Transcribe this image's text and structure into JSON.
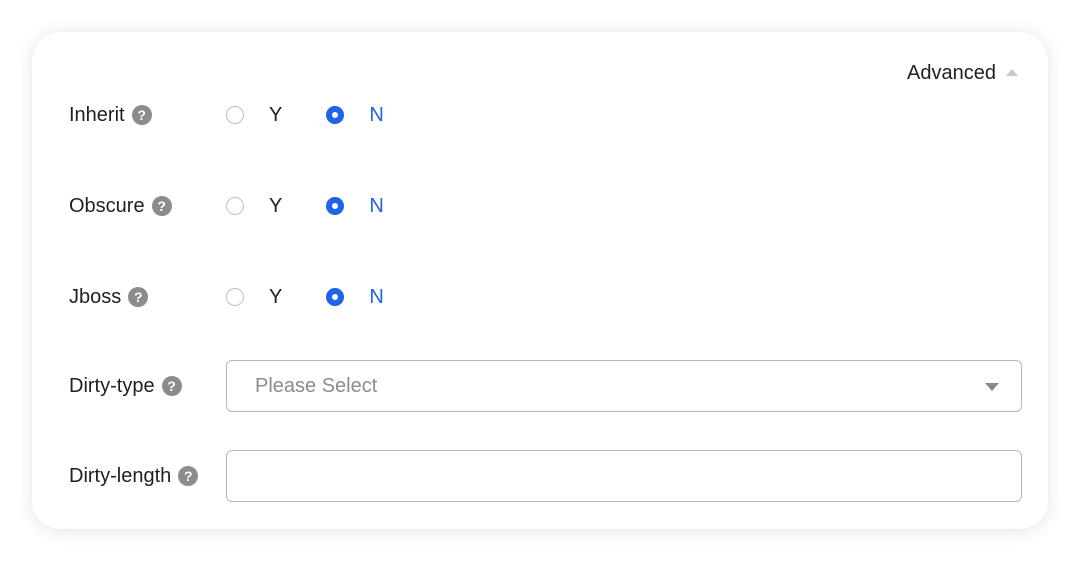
{
  "advanced": {
    "label": "Advanced",
    "icon": "chevron-up-icon"
  },
  "help_icon": {
    "glyph": "?",
    "icon": "question-circle-icon"
  },
  "fields": [
    {
      "label": "Inherit",
      "options": [
        "Y",
        "N"
      ],
      "selected": "N"
    },
    {
      "label": "Obscure",
      "options": [
        "Y",
        "N"
      ],
      "selected": "N"
    },
    {
      "label": "Jboss",
      "options": [
        "Y",
        "N"
      ],
      "selected": "N"
    }
  ],
  "dirty_type": {
    "label": "Dirty-type",
    "placeholder": "Please Select",
    "value": ""
  },
  "dirty_length": {
    "label": "Dirty-length",
    "value": ""
  },
  "colors": {
    "accent": "#1f63e8",
    "text": "#1f1f1f",
    "muted": "#8c8c8c",
    "border": "#b8b8b8"
  }
}
